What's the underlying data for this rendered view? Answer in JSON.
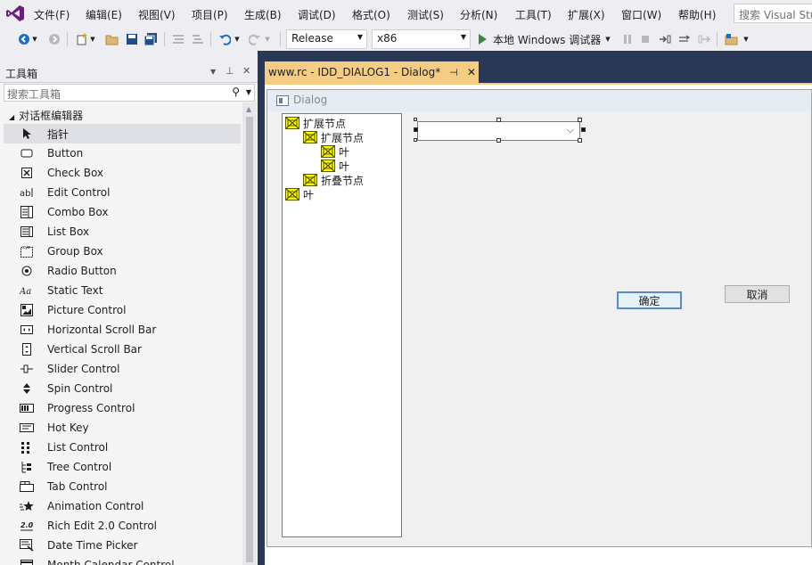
{
  "menubar": {
    "items": [
      "文件(F)",
      "编辑(E)",
      "视图(V)",
      "项目(P)",
      "生成(B)",
      "调试(D)",
      "格式(O)",
      "测试(S)",
      "分析(N)",
      "工具(T)",
      "扩展(X)",
      "窗口(W)",
      "帮助(H)"
    ],
    "search_placeholder": "搜索 Visual Stu"
  },
  "toolbar": {
    "configuration": "Release",
    "platform": "x86",
    "run_label": "本地 Windows 调试器"
  },
  "toolbox": {
    "title": "工具箱",
    "search_placeholder": "搜索工具箱",
    "group_label": "对话框编辑器",
    "items": [
      {
        "label": "指针",
        "icon": "pointer-icon"
      },
      {
        "label": "Button",
        "icon": "button-icon"
      },
      {
        "label": "Check Box",
        "icon": "checkbox-icon"
      },
      {
        "label": "Edit Control",
        "icon": "edit-control-icon"
      },
      {
        "label": "Combo Box",
        "icon": "combo-box-icon"
      },
      {
        "label": "List Box",
        "icon": "list-box-icon"
      },
      {
        "label": "Group Box",
        "icon": "group-box-icon"
      },
      {
        "label": "Radio Button",
        "icon": "radio-button-icon"
      },
      {
        "label": "Static Text",
        "icon": "static-text-icon"
      },
      {
        "label": "Picture Control",
        "icon": "picture-control-icon"
      },
      {
        "label": "Horizontal Scroll Bar",
        "icon": "hscroll-icon"
      },
      {
        "label": "Vertical Scroll Bar",
        "icon": "vscroll-icon"
      },
      {
        "label": "Slider Control",
        "icon": "slider-icon"
      },
      {
        "label": "Spin Control",
        "icon": "spin-icon"
      },
      {
        "label": "Progress Control",
        "icon": "progress-icon"
      },
      {
        "label": "Hot Key",
        "icon": "hotkey-icon"
      },
      {
        "label": "List Control",
        "icon": "list-control-icon"
      },
      {
        "label": "Tree Control",
        "icon": "tree-control-icon"
      },
      {
        "label": "Tab Control",
        "icon": "tab-control-icon"
      },
      {
        "label": "Animation Control",
        "icon": "animation-icon"
      },
      {
        "label": "Rich Edit 2.0 Control",
        "icon": "rich-edit-icon"
      },
      {
        "label": "Date Time Picker",
        "icon": "date-time-icon"
      },
      {
        "label": "Month Calendar Control",
        "icon": "calendar-icon"
      }
    ]
  },
  "document": {
    "tab_title": "www.rc - IDD_DIALOG1 - Dialog*",
    "dialog_title": "Dialog",
    "tree_nodes": [
      {
        "label": "扩展节点",
        "level": 0
      },
      {
        "label": "扩展节点",
        "level": 1
      },
      {
        "label": "叶",
        "level": 2
      },
      {
        "label": "叶",
        "level": 2
      },
      {
        "label": "折叠节点",
        "level": 1
      },
      {
        "label": "叶",
        "level": 0
      }
    ],
    "ok_label": "确定",
    "cancel_label": "取消"
  }
}
